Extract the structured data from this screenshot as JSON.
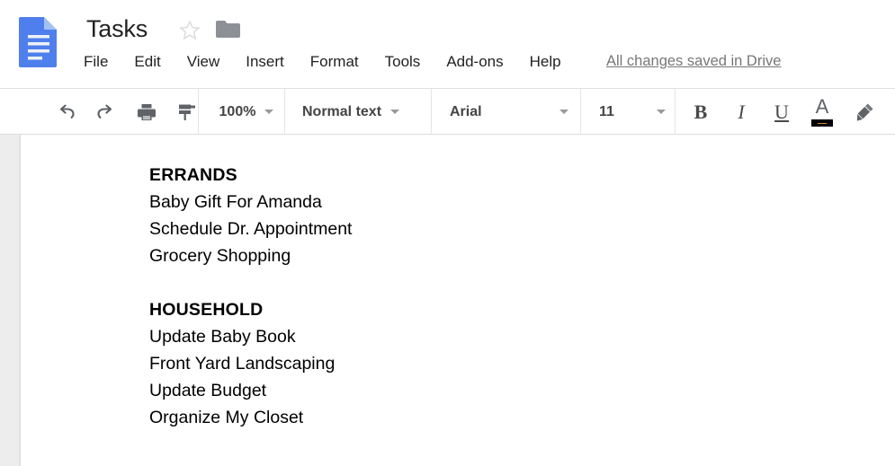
{
  "app": {
    "logo_icon": "google-docs-icon",
    "doc_title": "Tasks",
    "star_icon": "star-outline-icon",
    "folder_icon": "folder-icon",
    "save_status": "All changes saved in Drive"
  },
  "menubar": {
    "items": [
      {
        "label": "File"
      },
      {
        "label": "Edit"
      },
      {
        "label": "View"
      },
      {
        "label": "Insert"
      },
      {
        "label": "Format"
      },
      {
        "label": "Tools"
      },
      {
        "label": "Add-ons"
      },
      {
        "label": "Help"
      }
    ]
  },
  "toolbar": {
    "undo_icon": "undo-icon",
    "redo_icon": "redo-icon",
    "print_icon": "print-icon",
    "paint_format_icon": "paint-format-icon",
    "zoom_value": "100%",
    "style_value": "Normal text",
    "font_value": "Arial",
    "font_size_value": "11",
    "bold_label": "B",
    "italic_label": "I",
    "underline_label": "U",
    "text_color_label": "A",
    "text_color_swatch": "#000000",
    "highlight_icon": "highlighter-pen-icon"
  },
  "document": {
    "lines": [
      {
        "text": "ERRANDS",
        "heading": true
      },
      {
        "text": "Baby Gift For Amanda",
        "heading": false
      },
      {
        "text": "Schedule Dr. Appointment",
        "heading": false
      },
      {
        "text": "Grocery Shopping",
        "heading": false
      },
      {
        "text": "",
        "heading": false
      },
      {
        "text": "HOUSEHOLD",
        "heading": true
      },
      {
        "text": "Update Baby Book",
        "heading": false
      },
      {
        "text": "Front Yard Landscaping",
        "heading": false
      },
      {
        "text": "Update Budget",
        "heading": false
      },
      {
        "text": "Organize My Closet",
        "heading": false
      }
    ]
  }
}
